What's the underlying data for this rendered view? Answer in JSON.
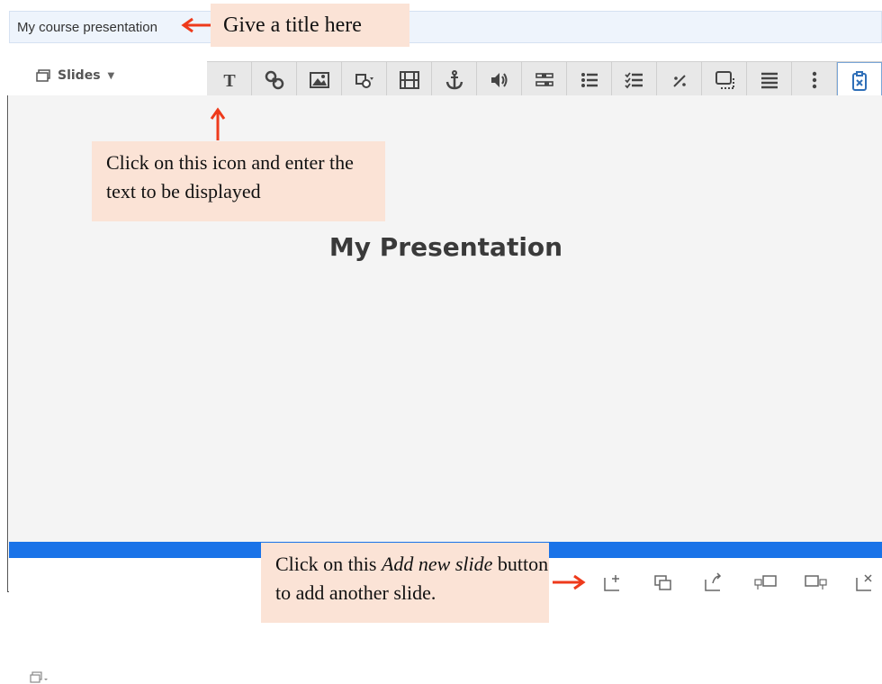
{
  "title_bar": {
    "title_value": "My course presentation"
  },
  "callouts": {
    "title_hint": "Give a title here",
    "text_hint": "Click on this icon and enter the text to be displayed",
    "slide_hint_pre": "Click on this ",
    "slide_hint_em": "Add new slide",
    "slide_hint_post": " button to add another slide."
  },
  "slides_menu": {
    "label": "Slides"
  },
  "toolbar": {
    "tools": [
      "text-icon",
      "link-icon",
      "image-icon",
      "shapes-icon",
      "video-icon",
      "anchor-icon",
      "audio-icon",
      "fill-in-blanks-icon",
      "single-choice-icon",
      "multi-choice-icon",
      "percent-icon",
      "dialog-cards-icon",
      "list-icon",
      "more-icon",
      "paste-icon"
    ]
  },
  "canvas": {
    "slide_title": "My Presentation"
  },
  "colors": {
    "accent_blue": "#1a73e8",
    "callout_bg": "#fbe3d6",
    "arrow_red": "#ee3a1b"
  },
  "bottom_tools": [
    "add-slide-icon",
    "clone-slide-icon",
    "move-slide-icon",
    "slide-left-icon",
    "slide-right-icon",
    "delete-slide-icon"
  ]
}
